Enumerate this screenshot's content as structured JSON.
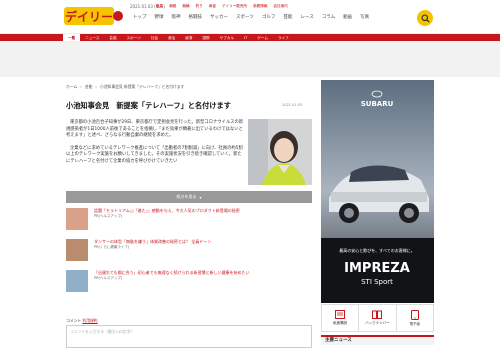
{
  "header": {
    "logo_text": "デイリー",
    "date": "2021.01.03 (Sun)",
    "links": [
      "競馬",
      "競艇",
      "競輪",
      "釣り",
      "麻雀",
      "デイリー販売所",
      "新着情報",
      "会社案内"
    ],
    "nav": [
      "トップ",
      "野球",
      "阪神",
      "格闘技",
      "サッカー",
      "スポーツ",
      "ゴルフ",
      "芸能",
      "レース",
      "コラム",
      "動画",
      "写真"
    ]
  },
  "category_bar": {
    "items": [
      "一覧",
      "ニュース",
      "芸能",
      "スポーツ",
      "社会",
      "政治",
      "経済",
      "国際",
      "サブカル",
      "IT",
      "ゲーム",
      "ライフ"
    ],
    "active_index": 0
  },
  "breadcrumb": [
    "ホーム",
    "芸能",
    "小池知事会見 新提案「テレハーフ」と名付けます"
  ],
  "article": {
    "title": "小池知事会見　新提案「テレハーフ」と名付けます",
    "date": "2021.01.03",
    "paragraphs": [
      "東京都の小池百合子知事が29日、東京都庁で定例会見を行った。新型コロナウイルスの新規感染者が1日1000人前後であることを指摘し「まだ効果が顕著に出ているわけではないと考えます」と述べ、さらなる行動自粛の継続を求めた。",
      "企業などに求めているテレワーク推進について「出勤者の7割削減」に向け、社員の約5割以上のテレワーク実施をお願いしてきました。その実施状況を引き続き確認していく。新たにテレハーフと名付けて企業の協力を呼びかけていきたい"
    ],
    "read_more": "続きを見る"
  },
  "related": [
    {
      "title": "話題「モラトリアム」」「着た」」感動を与え、今大人気のプロダクト新登場の秘密",
      "pr": "PR(ヘルスアップ)",
      "thumb_color": "#d9a08a"
    },
    {
      "title": "ダンサーの体型「無駄を嫌う」体質改善の秘密とは？ 全員ドーン",
      "pr": "PR(くらし健康ライフ)",
      "thumb_color": "#b88c6c"
    },
    {
      "title": "「出遅れても間に合う」初心者でも無理なく続けられる新習慣と新しい健康を始めたい",
      "pr": "PR(ヘルスアップ)",
      "thumb_color": "#8fb0c8"
    }
  ],
  "comment": {
    "label": "コメント",
    "link": "利用規約",
    "placeholder": "コメントを入力する（最大140文字）"
  },
  "sidebar": {
    "ad": {
      "brand": "SUBARU",
      "tagline": "最高の安心と歓びを、すべてのお客様に。",
      "model": "IMPREZA",
      "model_sub": "STI Sport"
    },
    "icons": [
      {
        "label": "紙面購読",
        "icon": "newspaper-icon"
      },
      {
        "label": "バックナンバー",
        "icon": "archive-icon"
      },
      {
        "label": "電子版",
        "icon": "tablet-icon"
      }
    ],
    "news_heading": "主要ニュース"
  },
  "colors": {
    "accent": "#c8161d",
    "logo": "#f5c400"
  }
}
